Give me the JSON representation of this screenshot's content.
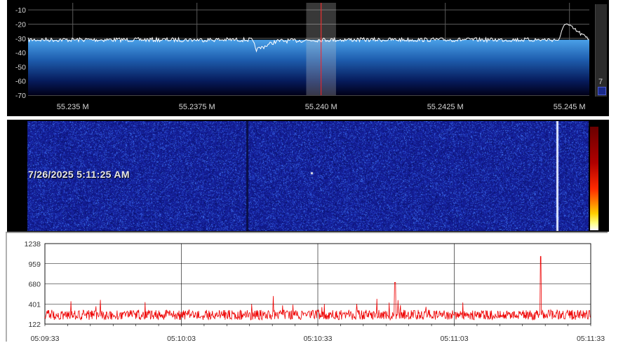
{
  "spectrum": {
    "y_tick_labels": [
      "-10",
      "-20",
      "-30",
      "-40",
      "-50",
      "-60",
      "-70"
    ],
    "y_tick_values": [
      -10,
      -20,
      -30,
      -40,
      -50,
      -60,
      -70
    ],
    "x_tick_labels": [
      "55.235 M",
      "55.2375 M",
      "55.240 M",
      "55.2425 M",
      "55.245 M"
    ],
    "x_tick_values": [
      55.235,
      55.2375,
      55.24,
      55.2425,
      55.245
    ],
    "x_range_mhz": [
      55.2341,
      55.2454
    ],
    "y_range_db": [
      -70,
      -5
    ],
    "noise_floor_db": -31,
    "center_frequency_mhz": 55.24,
    "filter_bandwidth_mhz": [
      55.2397,
      55.2403
    ],
    "gain_value": "7",
    "colors": {
      "trace": "#ffffff",
      "center_line": "#ff2020",
      "fill_top": "#3c8fd8",
      "fill_bottom": "#00002a",
      "grid": "#5a5a5a",
      "labels": "#d8d8d8"
    }
  },
  "waterfall": {
    "timestamp": "7/26/2025 5:11:25 AM",
    "colors": {
      "background": "#1a2a9a",
      "signal": "#e0e8ff"
    }
  },
  "timeseries": {
    "y_tick_labels": [
      "1238",
      "959",
      "680",
      "401",
      "122"
    ],
    "x_tick_labels": [
      "05:09:33",
      "05:10:03",
      "05:10:33",
      "05:11:03",
      "05:11:33"
    ],
    "colors": {
      "trace": "#ee0000",
      "grid": "#000000"
    }
  },
  "chart_data": [
    {
      "type": "line",
      "name": "spectrum",
      "x": [
        55.2341,
        55.2375,
        55.2386,
        55.2387,
        55.2391,
        55.24,
        55.2425,
        55.2448,
        55.2449,
        55.2454
      ],
      "y": [
        -31,
        -31,
        -31,
        -38,
        -32,
        -31,
        -31,
        -31,
        -19,
        -31
      ],
      "xlim": [
        55.2341,
        55.2454
      ],
      "ylim": [
        -70,
        -5
      ],
      "xlabel": "",
      "ylabel": "",
      "grid": true
    },
    {
      "type": "line",
      "name": "timeseries",
      "x": [
        "05:09:33",
        "05:10:03",
        "05:10:33",
        "05:10:50",
        "05:11:03",
        "05:11:22",
        "05:11:33"
      ],
      "y": [
        250,
        250,
        250,
        700,
        250,
        1060,
        250
      ],
      "ylim": [
        122,
        1238
      ],
      "xlabel": "",
      "ylabel": "",
      "grid": true
    }
  ]
}
